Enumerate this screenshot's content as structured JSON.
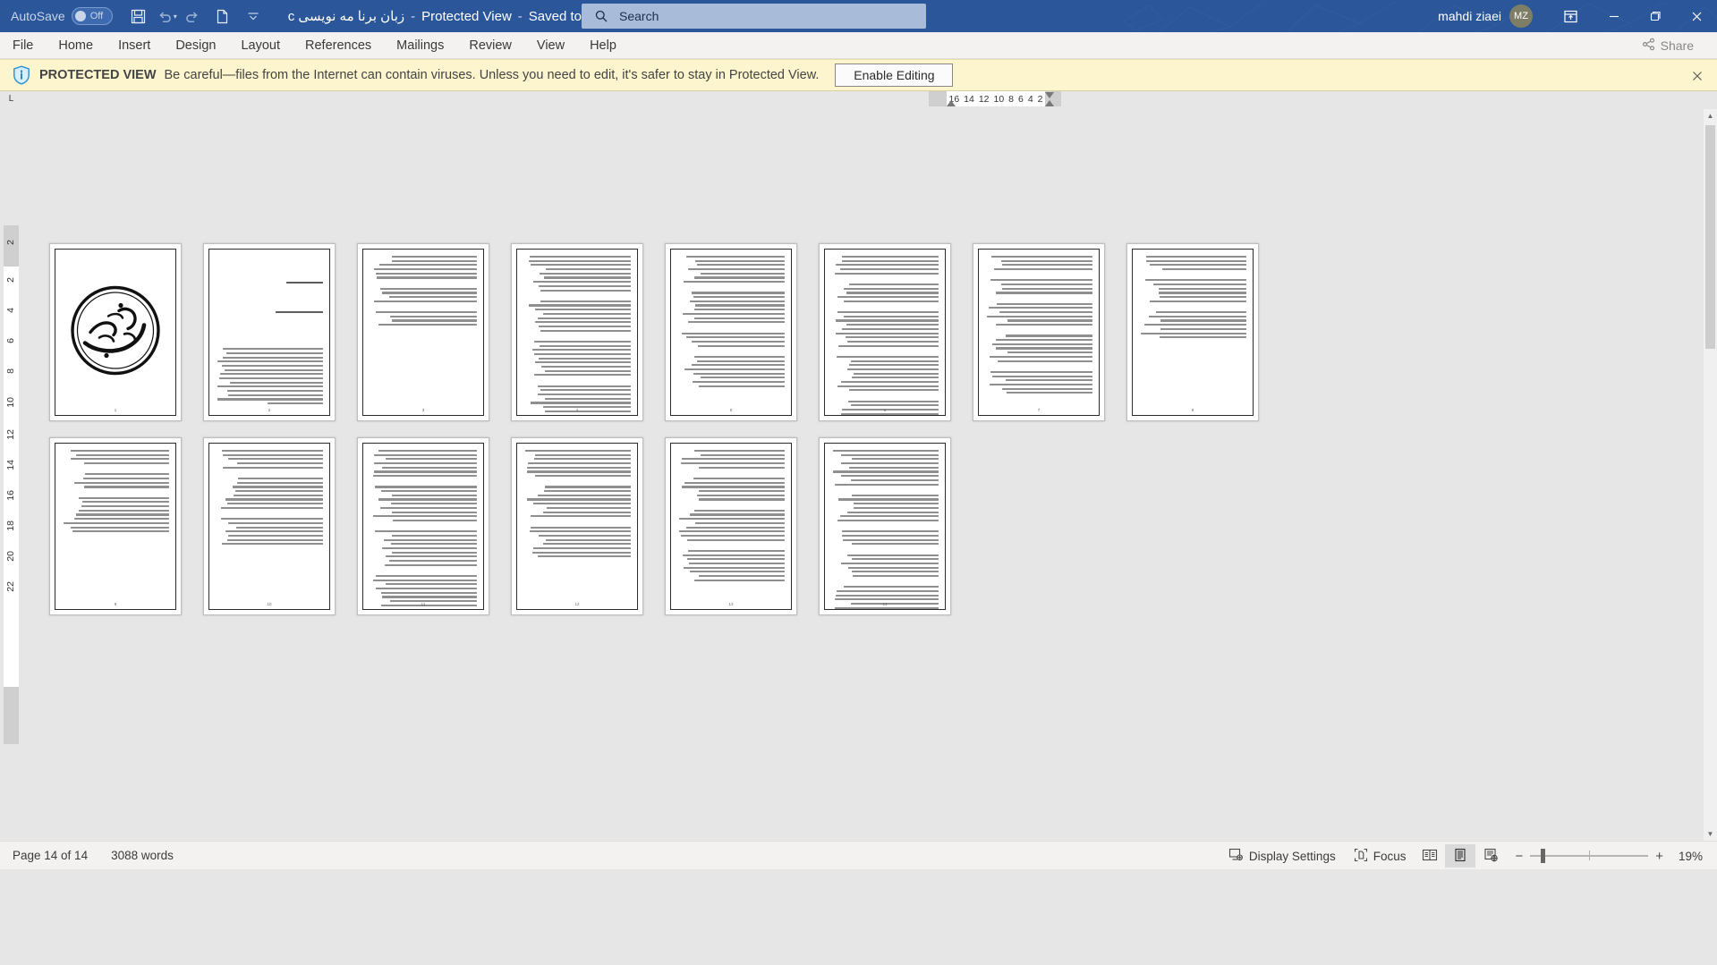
{
  "titlebar": {
    "autosave_label": "AutoSave",
    "autosave_state": "Off",
    "save_icon": "save-icon",
    "undo_icon": "undo-icon",
    "redo_icon": "redo-icon",
    "new_icon": "new-document-icon",
    "customize_icon": "customize-quick-access-toolbar-icon",
    "document_name": "زبان برنا مه نویسی c",
    "protected_view": "Protected View",
    "save_location": "Saved to this PC",
    "separator": "-",
    "account_name": "mahdi ziaei",
    "avatar_initials": "MZ",
    "ribbon_display_icon": "ribbon-display-options-icon",
    "minimize_icon": "minimize-icon",
    "restore_icon": "restore-icon",
    "close_icon": "close-icon",
    "accent_color": "#2b579a"
  },
  "search": {
    "placeholder": "Search",
    "icon": "search-icon",
    "value": ""
  },
  "ribbon": {
    "tabs": [
      {
        "label": "File"
      },
      {
        "label": "Home"
      },
      {
        "label": "Insert"
      },
      {
        "label": "Design"
      },
      {
        "label": "Layout"
      },
      {
        "label": "References"
      },
      {
        "label": "Mailings"
      },
      {
        "label": "Review"
      },
      {
        "label": "View"
      },
      {
        "label": "Help"
      }
    ],
    "share_label": "Share",
    "share_icon": "share-icon"
  },
  "banner": {
    "icon": "info-shield-icon",
    "title": "PROTECTED VIEW",
    "message": "Be careful—files from the Internet can contain viruses. Unless you need to edit, it's safer to stay in Protected View.",
    "button_label": "Enable Editing",
    "close_icon": "close-icon",
    "background": "#fdf5cd"
  },
  "ruler": {
    "corner_label": "L",
    "horizontal_ticks": [
      "16",
      "14",
      "12",
      "10",
      "8",
      "6",
      "4",
      "2"
    ],
    "vertical_ticks": [
      "2",
      "2",
      "4",
      "6",
      "8",
      "10",
      "12",
      "14",
      "16",
      "18",
      "20",
      "22"
    ]
  },
  "document": {
    "page_count": 14,
    "pages": [
      {
        "number": "1",
        "kind": "bismillah",
        "lines": []
      },
      {
        "number": "2",
        "kind": "text-sparse",
        "lines": []
      },
      {
        "number": "3",
        "kind": "text",
        "lines": []
      },
      {
        "number": "4",
        "kind": "text",
        "lines": []
      },
      {
        "number": "5",
        "kind": "text",
        "lines": []
      },
      {
        "number": "6",
        "kind": "text",
        "lines": []
      },
      {
        "number": "7",
        "kind": "text",
        "lines": []
      },
      {
        "number": "8",
        "kind": "text",
        "lines": []
      },
      {
        "number": "9",
        "kind": "text",
        "lines": []
      },
      {
        "number": "10",
        "kind": "text",
        "lines": []
      },
      {
        "number": "11",
        "kind": "text",
        "lines": []
      },
      {
        "number": "12",
        "kind": "text",
        "lines": []
      },
      {
        "number": "13",
        "kind": "text",
        "lines": []
      },
      {
        "number": "14",
        "kind": "text",
        "lines": []
      }
    ]
  },
  "statusbar": {
    "page_indicator": "Page 14 of 14",
    "word_count": "3088 words",
    "display_settings_label": "Display Settings",
    "display_settings_icon": "display-settings-icon",
    "focus_label": "Focus",
    "focus_icon": "focus-mode-icon",
    "read_mode_icon": "read-mode-icon",
    "print_layout_icon": "print-layout-icon",
    "web_layout_icon": "web-layout-icon",
    "zoom_out_label": "−",
    "zoom_in_label": "+",
    "zoom_level": "19%"
  }
}
